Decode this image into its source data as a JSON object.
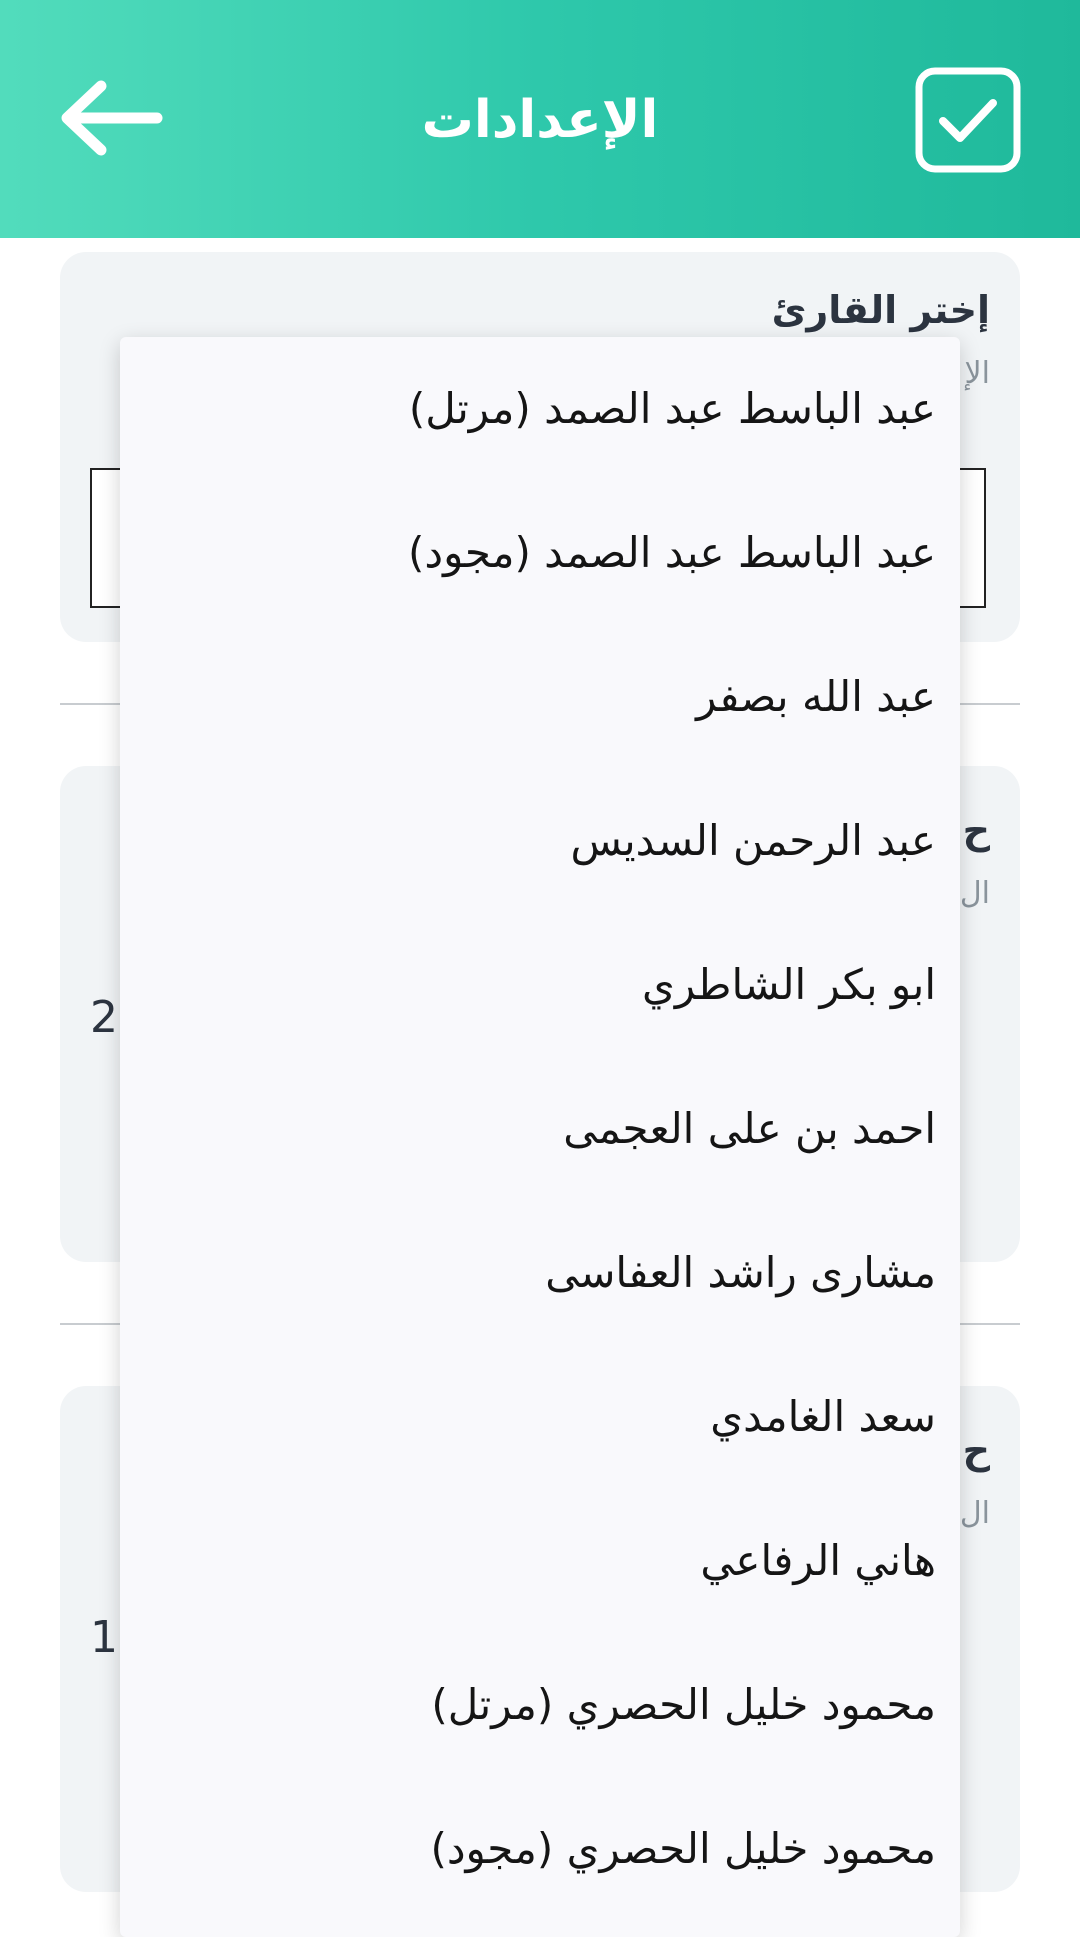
{
  "app_bar": {
    "title": "الإعدادات",
    "back_icon": "arrow-left-icon",
    "save_icon": "checkbox-check-icon",
    "gradient": [
      "#52dcbc",
      "#1fb99b"
    ]
  },
  "settings": {
    "reciter_card": {
      "title": "إختر القارئ",
      "subtitle": "الإ"
    },
    "card_two": {
      "title": "ح",
      "subtitle": "ال",
      "value": "2"
    },
    "card_three": {
      "title": "ح",
      "subtitle": "ال",
      "value": "1"
    }
  },
  "reciter_dropdown": {
    "items": [
      "عبد الباسط عبد الصمد (مرتل)",
      "عبد الباسط عبد الصمد (مجود)",
      "عبد الله بصفر",
      "عبد الرحمن السديس",
      "ابو بكر الشاطري",
      "احمد بن علی العجمی",
      "مشاری راشد العفاسی",
      "سعد الغامدي",
      "هاني الرفاعي",
      "محمود خليل الحصري (مرتل)",
      "محمود خليل الحصري (مجود)"
    ]
  }
}
